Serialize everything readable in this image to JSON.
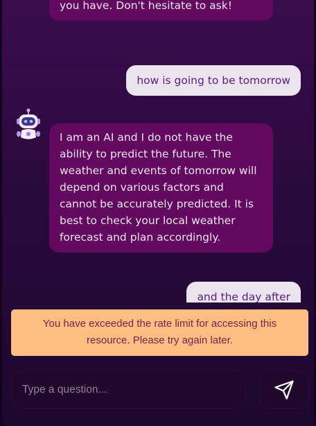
{
  "messages": [
    {
      "role": "bot",
      "text": "here to help you with any questions you have. Don't hesitate to ask!"
    },
    {
      "role": "user",
      "text": "how is going to be tomorrow"
    },
    {
      "role": "bot",
      "text": "I am an AI and I do not have the ability to predict the future. The weather and events of tomorrow will depend on various factors and cannot be accurately predicted. It is best to check your local weather forecast and plan accordingly."
    },
    {
      "role": "user",
      "text": "and the day after"
    }
  ],
  "alert": {
    "text": "You have exceeded the rate limit for accessing this resource. Please try again later."
  },
  "composer": {
    "placeholder": "Type a question...",
    "send_icon": "send-icon"
  },
  "avatar": {
    "icon": "robot-icon"
  },
  "colors": {
    "background": "#2a0a3c",
    "bot_bubble": "#62095f",
    "user_bubble": "#e9e4ee",
    "alert_bg": "#ffbe82",
    "alert_text": "#7a1f4a",
    "input_bg": "#21072c"
  }
}
